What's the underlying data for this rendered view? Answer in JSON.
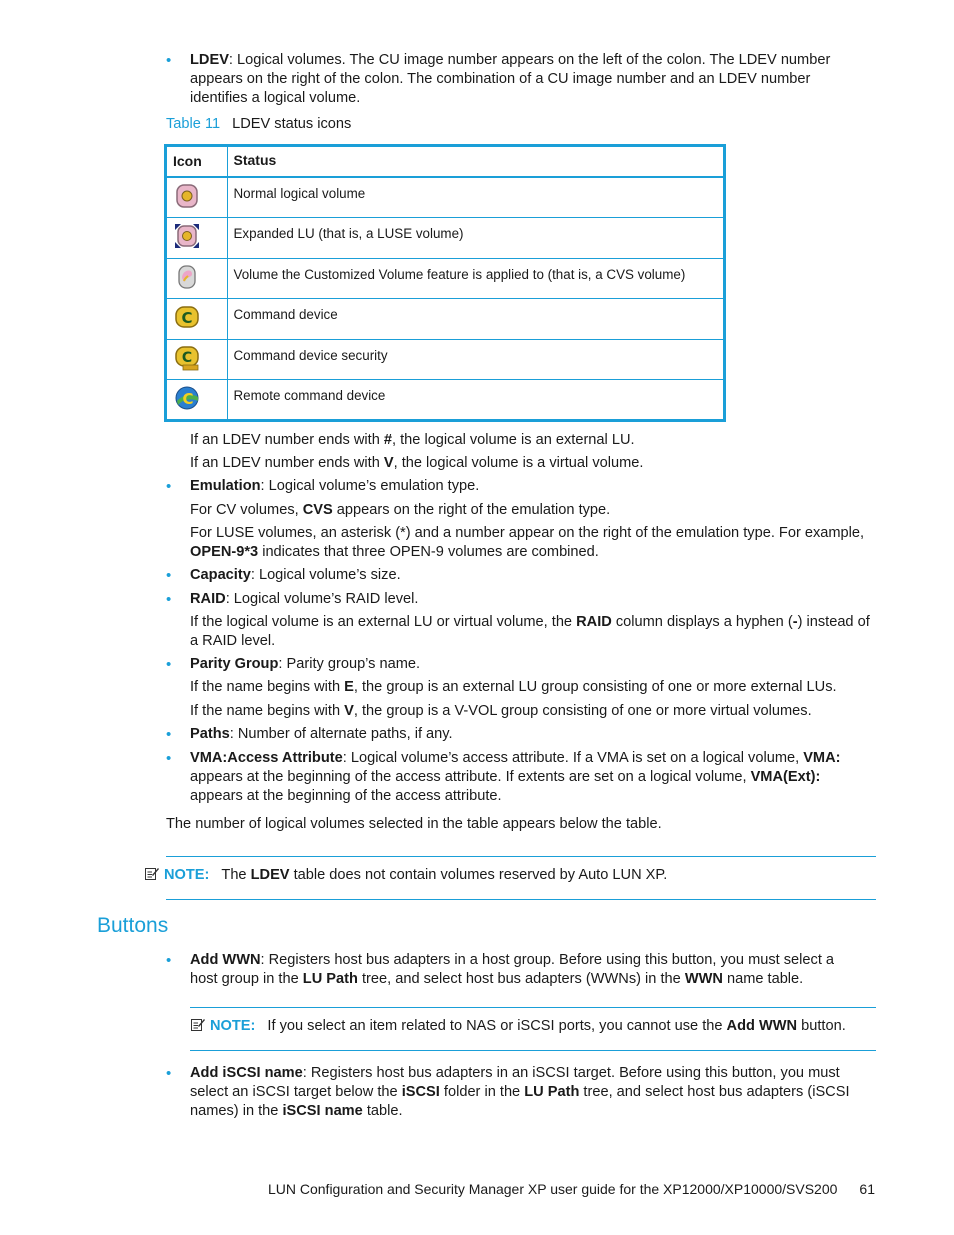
{
  "ldev_item": {
    "term": "LDEV",
    "text": ": Logical volumes. The CU image number appears on the left of the colon. The LDEV number appears on the right of the colon. The combination of a CU image number and an LDEV number identifies a logical volume."
  },
  "table_caption": {
    "number": "Table 11",
    "title": "LDEV status icons"
  },
  "table": {
    "headers": [
      "Icon",
      "Status"
    ],
    "rows": [
      {
        "icon": "normal-logical-volume-icon",
        "status": "Normal logical volume"
      },
      {
        "icon": "expanded-lu-icon",
        "status": "Expanded LU (that is, a LUSE volume)"
      },
      {
        "icon": "cvs-volume-icon",
        "status": "Volume the Customized Volume feature is applied to (that is, a CVS volume)"
      },
      {
        "icon": "command-device-icon",
        "status": "Command device"
      },
      {
        "icon": "command-device-security-icon",
        "status": "Command device security"
      },
      {
        "icon": "remote-command-device-icon",
        "status": "Remote command device"
      }
    ]
  },
  "ldev_notes": {
    "hash_pre": "If an LDEV number ends with ",
    "hash_bold": "#",
    "hash_post": ", the logical volume is an external LU.",
    "v_pre": "If an LDEV number ends with ",
    "v_bold": "V",
    "v_post": ", the logical volume is a virtual volume."
  },
  "emulation": {
    "term": "Emulation",
    "text": ": Logical volume’s emulation type.",
    "cv_pre": "For CV volumes, ",
    "cv_bold": "CVS",
    "cv_post": " appears on the right of the emulation type.",
    "luse_pre": "For LUSE volumes, an asterisk (*) and a number appear on the right of the emulation type. For example, ",
    "luse_bold": "OPEN-9*3",
    "luse_post": " indicates that three OPEN-9 volumes are combined."
  },
  "capacity": {
    "term": "Capacity",
    "text": ": Logical volume’s size."
  },
  "raid": {
    "term": "RAID",
    "text": ": Logical volume’s RAID level.",
    "note_pre": "If the logical volume is an external LU or virtual volume, the ",
    "note_bold": "RAID",
    "note_mid": " column displays a hyphen (",
    "note_bold2": "-",
    "note_post": ") instead of a RAID level."
  },
  "parity_group": {
    "term": "Parity Group",
    "text": ": Parity group’s name.",
    "e_pre": "If the name begins with ",
    "e_bold": "E",
    "e_post": ", the group is an external LU group consisting of one or more external LUs.",
    "v_pre": "If the name begins with ",
    "v_bold": "V",
    "v_post": ", the group is a V-VOL group consisting of one or more virtual volumes."
  },
  "paths": {
    "term": "Paths",
    "text": ": Number of alternate paths, if any."
  },
  "vma": {
    "term": "VMA:Access Attribute",
    "text1": ": Logical volume’s access attribute. If a VMA is set on a logical volume, ",
    "bold1": "VMA:",
    "text2": " appears at the beginning of the access attribute. If extents are set on a logical volume, ",
    "bold2": "VMA(Ext):",
    "text3": " appears at the beginning of the access attribute."
  },
  "selected_count_text": "The number of logical volumes selected in the table appears below the table.",
  "note1": {
    "label": "NOTE:",
    "pre": "The ",
    "bold": "LDEV",
    "post": " table does not contain volumes reserved by Auto LUN XP."
  },
  "section": {
    "title": "Buttons"
  },
  "add_wwn": {
    "term": "Add WWN",
    "t1": ": Registers host bus adapters in a host group. Before using this button, you must select a host group in the ",
    "b1": "LU Path",
    "t2": " tree, and select host bus adapters (WWNs) in the ",
    "b2": "WWN",
    "t3": " name table."
  },
  "note2": {
    "label": "NOTE:",
    "pre": "If you select an item related to NAS or iSCSI ports, you cannot use the ",
    "bold": "Add WWN",
    "post": " button."
  },
  "add_iscsi": {
    "term": "Add iSCSI name",
    "t1": ": Registers host bus adapters in an iSCSI target. Before using this button, you must select an iSCSI target below the ",
    "b1": "iSCSI",
    "t2": " folder in the ",
    "b2": "LU Path",
    "t3": " tree, and select host bus adapters (iSCSI names) in the ",
    "b3": "iSCSI name",
    "t4": " table."
  },
  "footer": {
    "title": "LUN Configuration and Security Manager XP user guide for the XP12000/XP10000/SVS200",
    "page": "61"
  },
  "colors": {
    "accent": "#1a9fd8",
    "text": "#1a1a1a"
  }
}
